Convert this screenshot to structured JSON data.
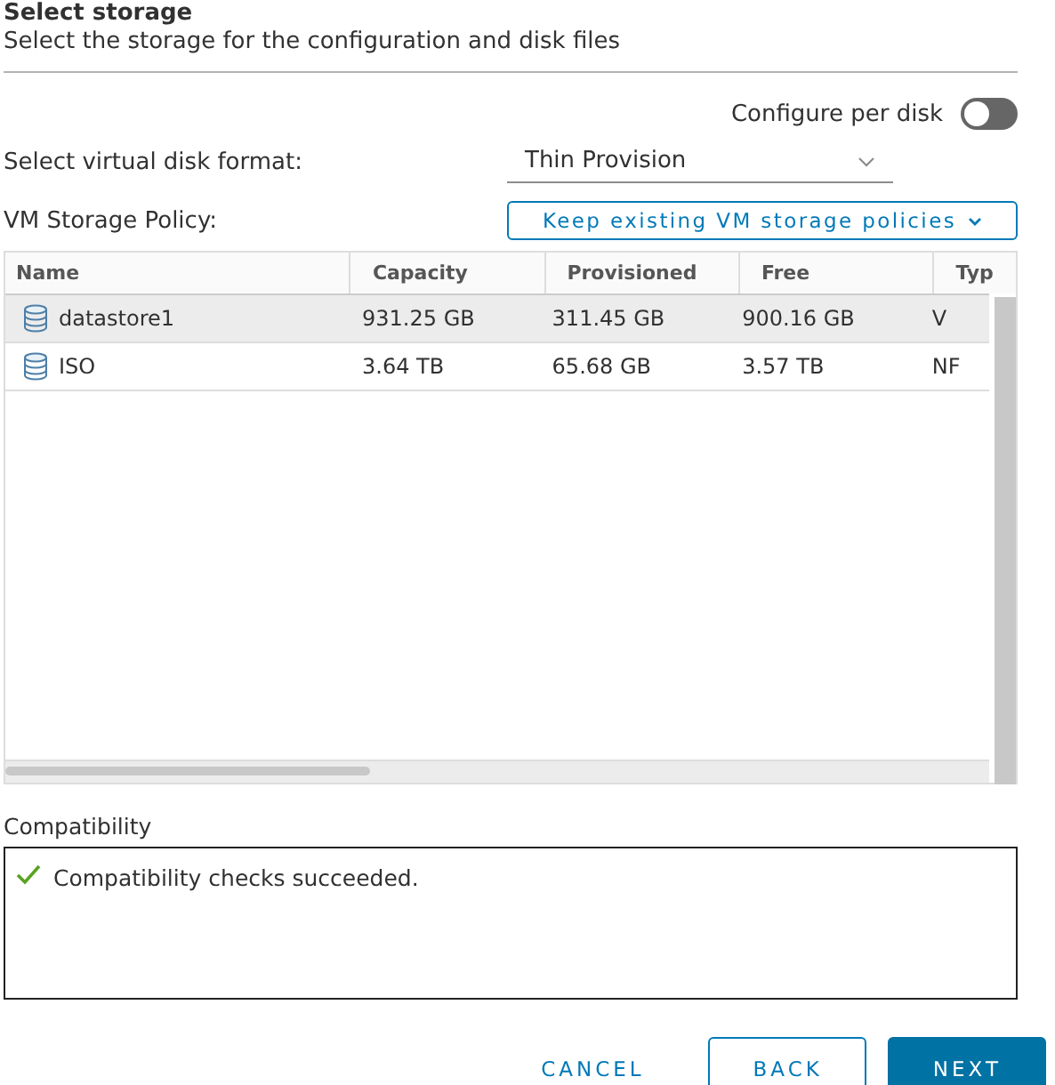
{
  "header": {
    "title": "Select storage",
    "subtitle": "Select the storage for the configuration and disk files"
  },
  "configure_per_disk": {
    "label": "Configure per disk",
    "on": false
  },
  "disk_format": {
    "label": "Select virtual disk format:",
    "value": "Thin Provision"
  },
  "storage_policy": {
    "label": "VM Storage Policy:",
    "value": "Keep existing VM storage policies"
  },
  "table": {
    "columns": [
      "Name",
      "Capacity",
      "Provisioned",
      "Free",
      "Typ"
    ],
    "rows": [
      {
        "name": "datastore1",
        "capacity": "931.25 GB",
        "provisioned": "311.45 GB",
        "free": "900.16 GB",
        "type": "V",
        "selected": true
      },
      {
        "name": "ISO",
        "capacity": "3.64 TB",
        "provisioned": "65.68 GB",
        "free": "3.57 TB",
        "type": "NF",
        "selected": false
      }
    ]
  },
  "compatibility": {
    "label": "Compatibility",
    "message": "Compatibility checks succeeded.",
    "ok": true
  },
  "buttons": [
    {
      "label": "CANCEL",
      "kind": "flat"
    },
    {
      "label": "BACK",
      "kind": "outline"
    },
    {
      "label": "NEXT",
      "kind": "primary"
    }
  ]
}
